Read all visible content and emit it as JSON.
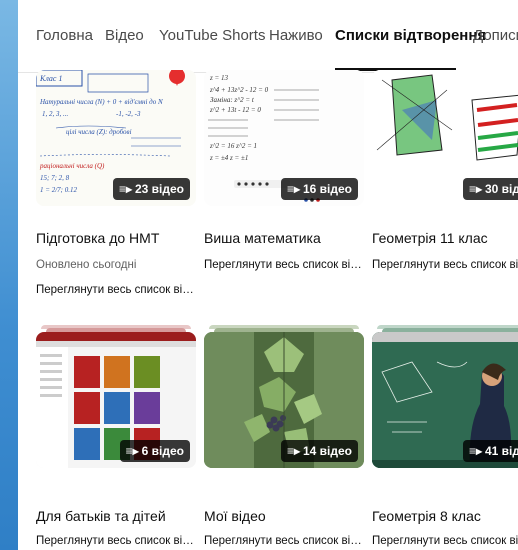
{
  "tabs": [
    "Головна",
    "Відео",
    "YouTube Shorts",
    "Наживо",
    "Списки відтворення",
    "Дописи"
  ],
  "active_tab_index": 4,
  "playlists": [
    {
      "title": "Підготовка до НМТ",
      "count": "23 відео",
      "line1": "Оновлено сьогодні",
      "line2": "Переглянути весь список відтворе..."
    },
    {
      "title": "Виша математика",
      "count": "16 відео",
      "line1": "Переглянути весь список відтворе..."
    },
    {
      "title": "Геометрія 11 клас",
      "count": "30 від",
      "line1": "Переглянути весь список відтворе"
    },
    {
      "title": "Для батьків та дітей",
      "count": "6 відео",
      "line1": "Переглянути весь список відтворе..."
    },
    {
      "title": "Мої відео",
      "count": "14 відео",
      "line1": "Переглянути весь список відтворе..."
    },
    {
      "title": "Геометрія 8 клас",
      "count": "41 від",
      "line1": "Переглянути весь список відтворе"
    }
  ],
  "thumb_text": {
    "p1_header": "Клас 1",
    "p1_lines": [
      "Натуральні числа (N) + 0 + від'ємні до N",
      "1, 2, 3, ...",
      "-1, -2, -3",
      "цілі числа (Z): дробові",
      "раціональні числа (Q)",
      "15; 7; 2, 8",
      "1 = 2/7; 0.12"
    ],
    "p2_lines": [
      "z = 13",
      "z^4 + 13z^2 - 12 = 0",
      "Заміна: z^2 = t",
      "z^2 + 13t - 12 = 0",
      "z^2 = 16   z^2 = 1",
      "z = ±4    z = ±1"
    ]
  },
  "icons": [
    "playlist-icon"
  ],
  "colors": {
    "accent": "#0f0f0f",
    "muted": "#606060",
    "badge_bg": "#000000",
    "browser_bg": "#3f8ed1"
  }
}
